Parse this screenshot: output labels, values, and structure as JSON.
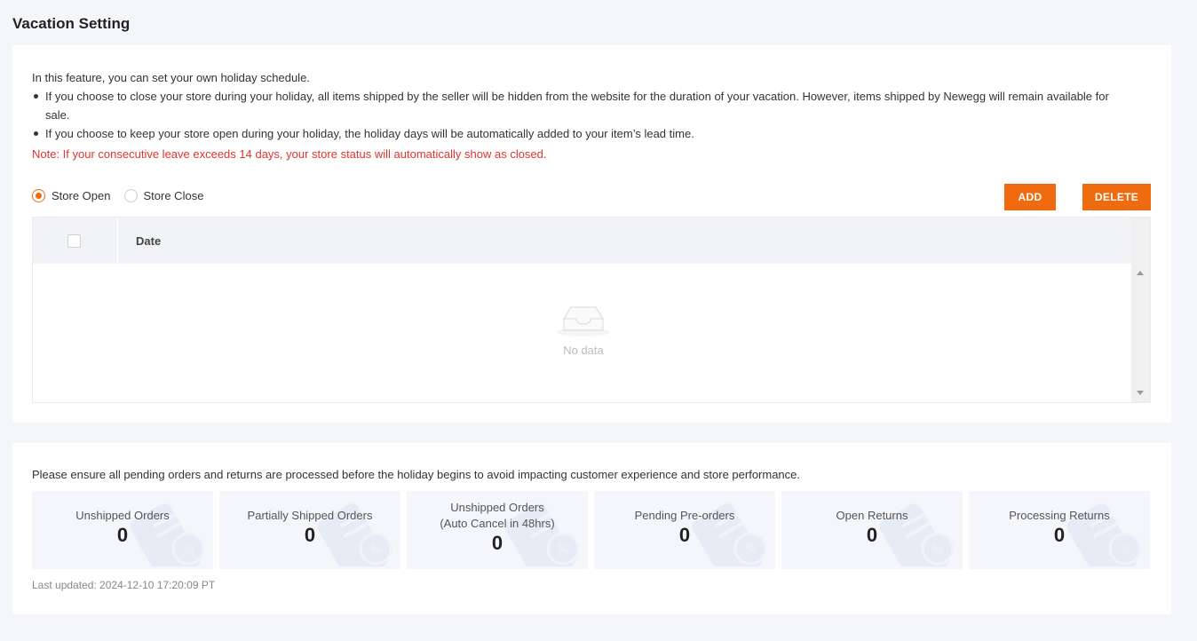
{
  "page": {
    "title": "Vacation Setting"
  },
  "intro": {
    "text": "In this feature, you can set your own holiday schedule.",
    "bullets": [
      "If you choose to close your store during your holiday, all items shipped by the seller will be hidden from the website for the duration of your vacation. However, items shipped by Newegg will remain available for sale.",
      "If you choose to keep your store open during your holiday, the holiday days will be automatically added to your item’s lead time."
    ],
    "note": "Note: If your consecutive leave exceeds 14 days, your store status will automatically show as closed."
  },
  "radios": {
    "open_label": "Store Open",
    "close_label": "Store Close",
    "selected": "open"
  },
  "buttons": {
    "add": "ADD",
    "delete": "DELETE"
  },
  "table": {
    "date_header": "Date",
    "empty_text": "No data"
  },
  "pending": {
    "text": "Please ensure all pending orders and returns are processed before the holiday begins to avoid impacting customer experience and store performance.",
    "stats": [
      {
        "line1": "Unshipped Orders",
        "line2": "",
        "value": "0"
      },
      {
        "line1": "Partially Shipped Orders",
        "line2": "",
        "value": "0"
      },
      {
        "line1": "Unshipped Orders",
        "line2": "(Auto Cancel in 48hrs)",
        "value": "0"
      },
      {
        "line1": "Pending Pre-orders",
        "line2": "",
        "value": "0"
      },
      {
        "line1": "Open Returns",
        "line2": "",
        "value": "0"
      },
      {
        "line1": "Processing Returns",
        "line2": "",
        "value": "0"
      }
    ],
    "last_updated": "Last updated: 2024-12-10 17:20:09 PT"
  },
  "colors": {
    "accent": "#f06a0f",
    "note": "#e0342f",
    "stat_bg": "#f4f6fb"
  }
}
